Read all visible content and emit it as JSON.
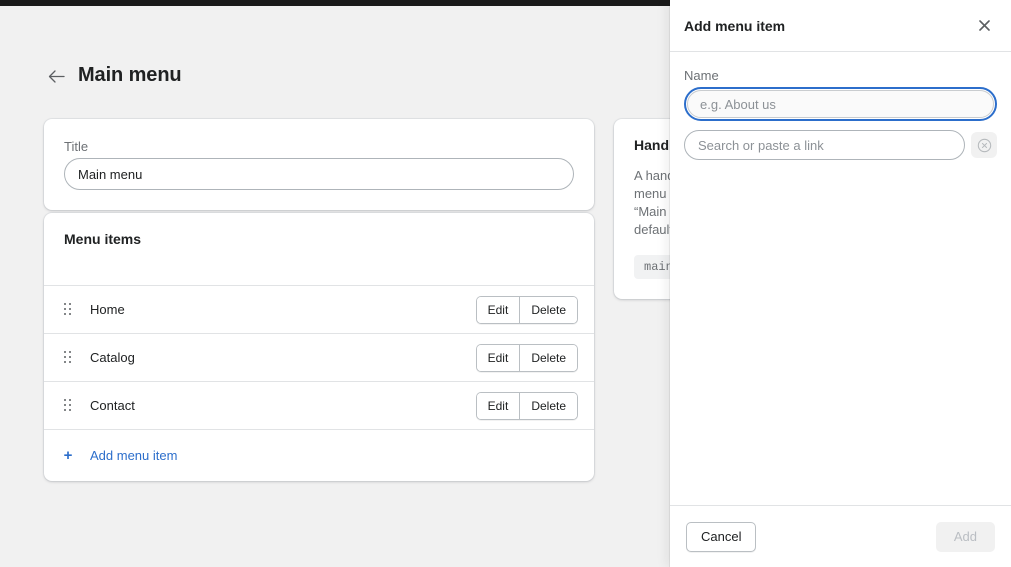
{
  "page": {
    "back_icon": "arrow-left-icon",
    "title": "Main menu",
    "title_card": {
      "label": "Title",
      "value": "Main menu"
    },
    "menu_items_card": {
      "heading": "Menu items",
      "rows": [
        {
          "label": "Home",
          "edit": "Edit",
          "delete": "Delete"
        },
        {
          "label": "Catalog",
          "edit": "Edit",
          "delete": "Delete"
        },
        {
          "label": "Contact",
          "edit": "Edit",
          "delete": "Delete"
        }
      ],
      "add_label": "Add menu item",
      "add_icon": "plus-icon"
    },
    "handle_card": {
      "heading": "Handle",
      "body": "A handle is used to reference the menu in Liquid. e.g. the handle for “Main menu” will be main-menu by default.",
      "chip": "main-menu"
    }
  },
  "drawer": {
    "title": "Add menu item",
    "close_icon": "close-icon",
    "name_label": "Name",
    "name_value": "",
    "name_placeholder": "e.g. About us",
    "link_value": "",
    "link_placeholder": "Search or paste a link",
    "clear_icon": "circle-x-icon",
    "cancel_label": "Cancel",
    "add_label": "Add"
  },
  "colors": {
    "accent": "#2c6ecb",
    "topbar": "#1a1a1a",
    "page_bg": "#f1f1f1",
    "text": "#202223",
    "muted": "#6d7175"
  }
}
